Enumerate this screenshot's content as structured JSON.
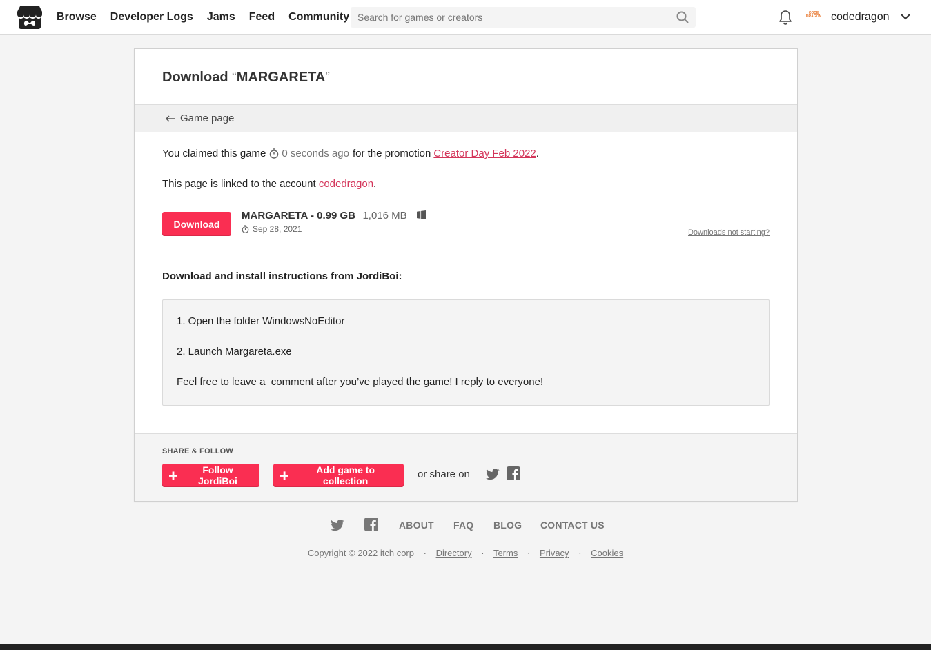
{
  "header": {
    "nav": [
      "Browse",
      "Developer Logs",
      "Jams",
      "Feed",
      "Community"
    ],
    "search_placeholder": "Search for games or creators",
    "avatar_text": "CODE DRAGON",
    "username": "codedragon"
  },
  "page": {
    "title_prefix": "Download",
    "open_quote": "“",
    "game_title": "MARGARETA",
    "close_quote": "”",
    "back_link": "Game page",
    "claim_prefix": "You claimed this game",
    "claim_time": "0 seconds ago",
    "claim_mid": "for the promotion",
    "promotion": "Creator Day Feb 2022",
    "period": ".",
    "linked_prefix": "This page is linked to the account",
    "linked_account": "codedragon",
    "download_button": "Download",
    "upload_name": "MARGARETA - 0.99 GB",
    "upload_size": "1,016 MB",
    "upload_date": "Sep 28, 2021",
    "not_starting": "Downloads not starting?",
    "instructions_title": "Download and install instructions from JordiBoi:",
    "instructions": [
      "1. Open the folder WindowsNoEditor",
      "2. Launch Margareta.exe",
      "Feel free to leave a  comment after you’ve played the game! I reply to everyone!"
    ]
  },
  "share": {
    "heading": "SHARE & FOLLOW",
    "follow_button": "Follow JordiBoi",
    "collection_button": "Add game to collection",
    "share_text": "or share on"
  },
  "footer": {
    "links": [
      "ABOUT",
      "FAQ",
      "BLOG",
      "CONTACT US"
    ],
    "copyright": "Copyright © 2022 itch corp",
    "legal": [
      "Directory",
      "Terms",
      "Privacy",
      "Cookies"
    ],
    "separator": "·"
  },
  "colors": {
    "accent": "#fa2e52",
    "link": "#d4355a"
  }
}
